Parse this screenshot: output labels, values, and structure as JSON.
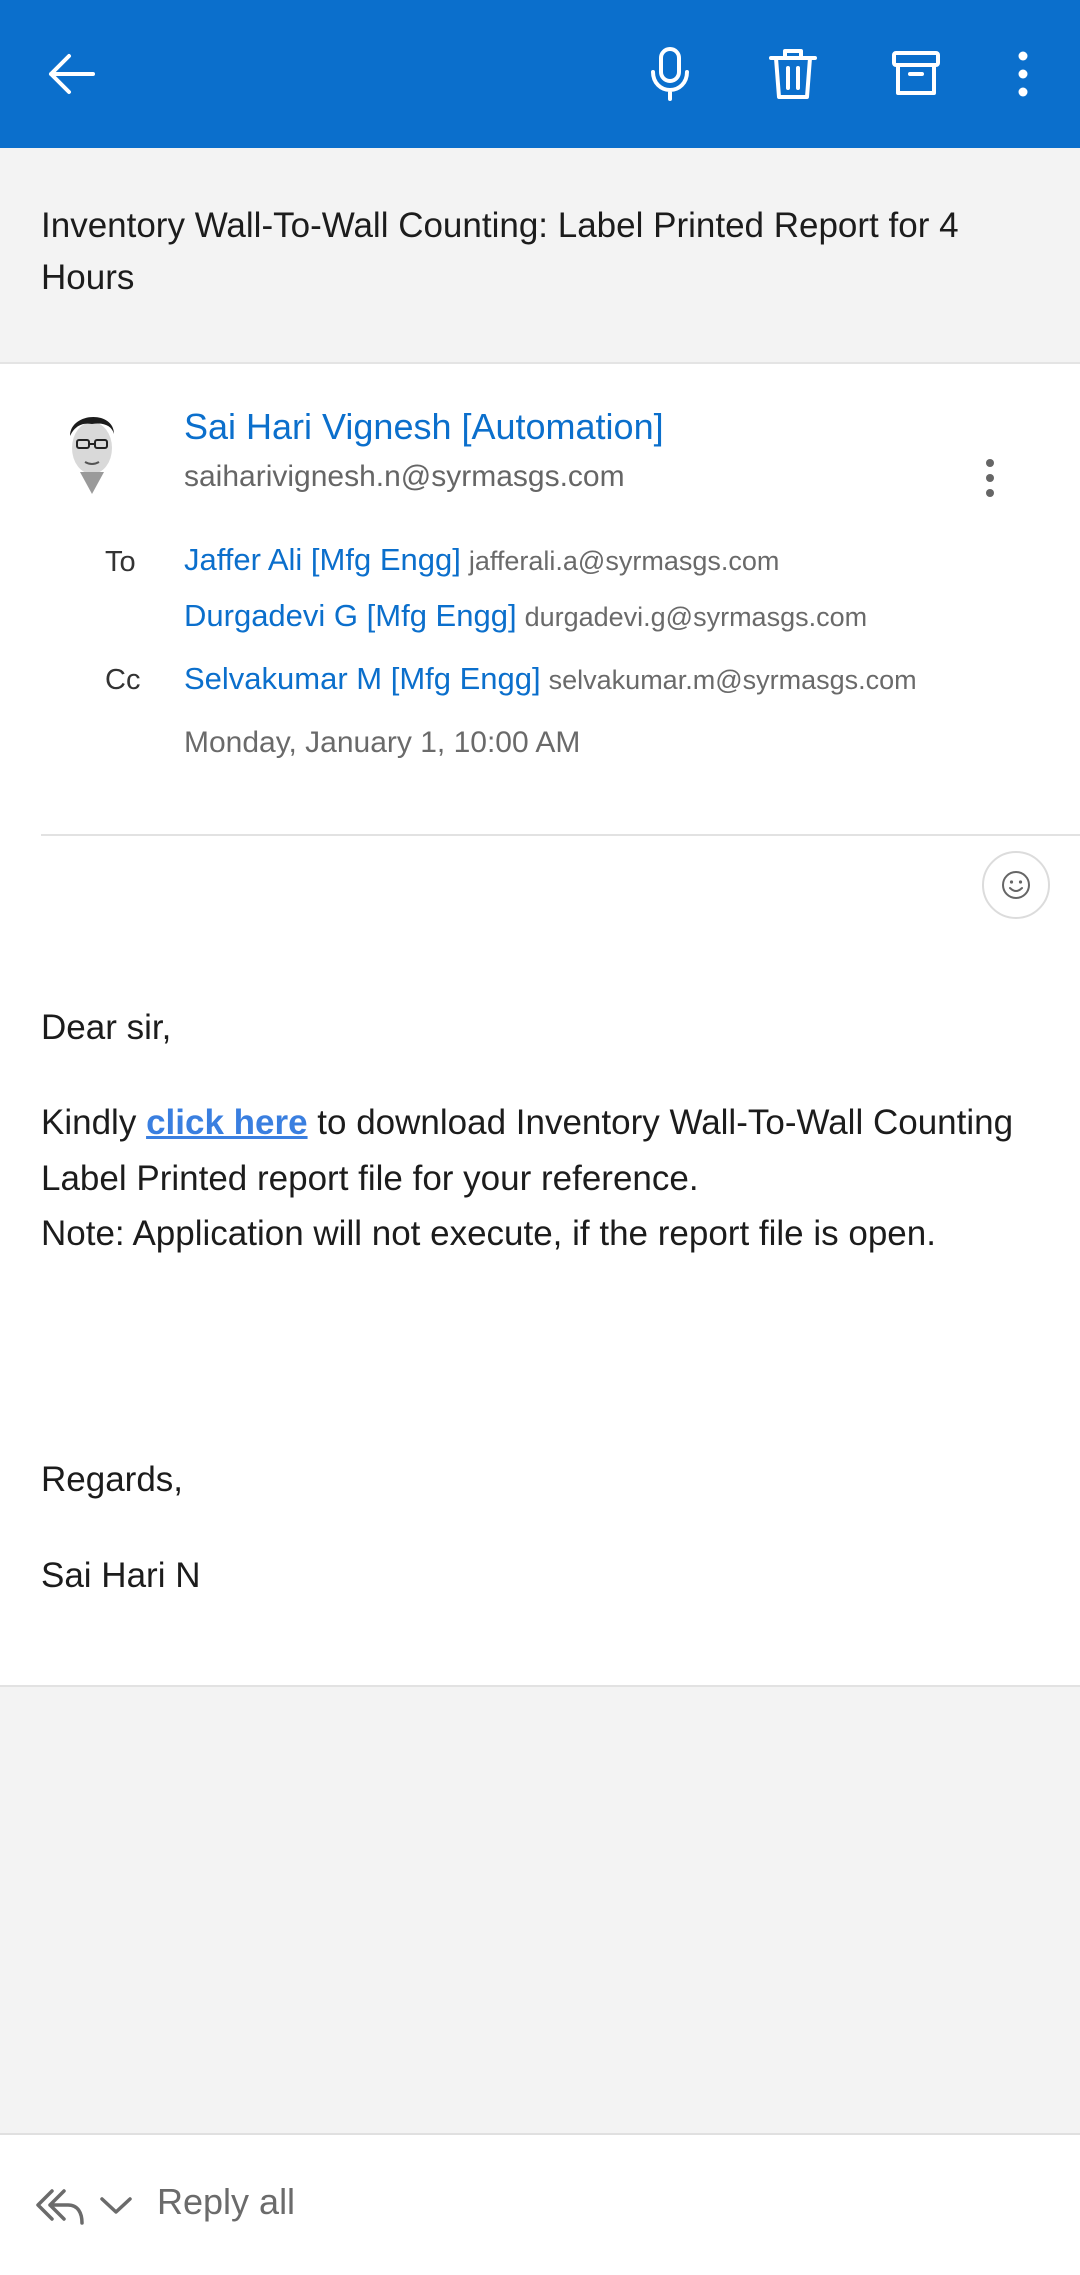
{
  "toolbar": {
    "back_icon": "back-arrow-icon",
    "mic_icon": "microphone-icon",
    "delete_icon": "trash-icon",
    "archive_icon": "archive-icon",
    "more_icon": "more-vertical-icon",
    "accent_color": "#0b6fcc"
  },
  "subject": "Inventory Wall-To-Wall Counting: Label Printed Report for 4 Hours",
  "message": {
    "sender_name": "Sai Hari Vignesh [Automation]",
    "sender_email": "saiharivignesh.n@syrmasgs.com",
    "to_label": "To",
    "cc_label": "Cc",
    "to": [
      {
        "name": "Jaffer Ali [Mfg Engg]",
        "email": "jafferali.a@syrmasgs.com"
      },
      {
        "name": "Durgadevi G [Mfg Engg]",
        "email": "durgadevi.g@syrmasgs.com"
      }
    ],
    "cc": [
      {
        "name": "Selvakumar M [Mfg Engg]",
        "email": "selvakumar.m@syrmasgs.com"
      }
    ],
    "date": "Monday, January 1, 10:00 AM",
    "react_icon": "smiley-icon"
  },
  "body": {
    "greeting": "Dear sir,",
    "line1_before": "Kindly ",
    "link_text": "click here",
    "line1_after": " to download Inventory Wall-To-Wall Counting Label Printed report file for your reference.",
    "note": "Note: Application will not execute, if the report file is open.",
    "closing": "Regards,",
    "signature": "Sai Hari N"
  },
  "reply": {
    "label": "Reply all",
    "icon": "reply-all-icon",
    "chevron": "chevron-down-icon"
  }
}
